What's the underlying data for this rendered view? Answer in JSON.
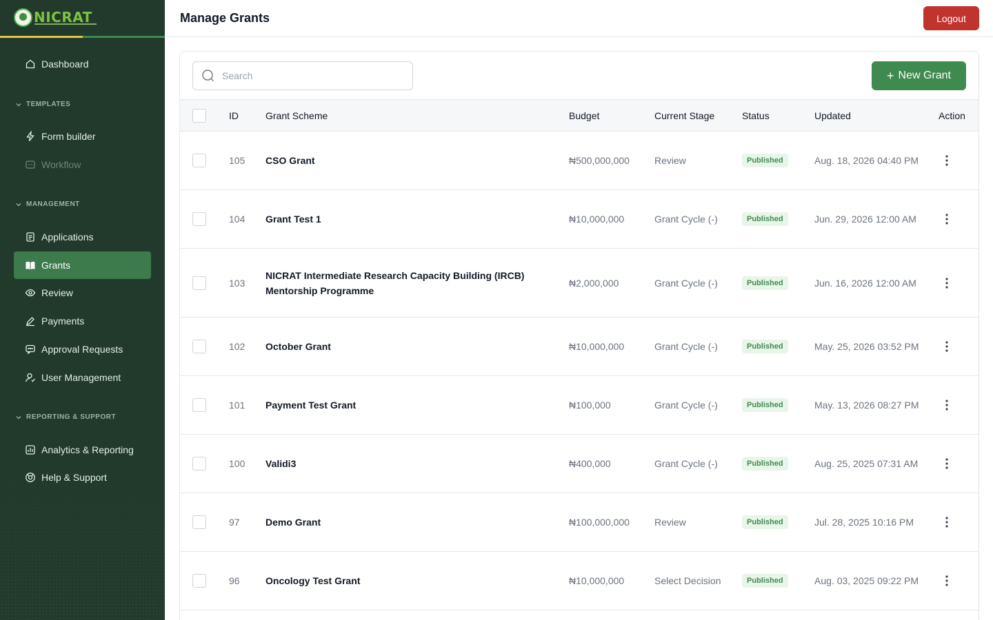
{
  "brand": {
    "name": "NICRAT"
  },
  "sidebar": {
    "items": [
      {
        "label": "Dashboard"
      },
      {
        "label": "Form builder"
      },
      {
        "label": "Workflow"
      },
      {
        "label": "Applications"
      },
      {
        "label": "Grants"
      },
      {
        "label": "Review"
      },
      {
        "label": "Payments"
      },
      {
        "label": "Approval Requests"
      },
      {
        "label": "User Management"
      },
      {
        "label": "Analytics & Reporting"
      },
      {
        "label": "Help & Support"
      }
    ],
    "sections": [
      {
        "label": "TEMPLATES"
      },
      {
        "label": "MANAGEMENT"
      },
      {
        "label": "REPORTING & SUPPORT"
      }
    ],
    "active_item": "Grants"
  },
  "header": {
    "title": "Manage Grants",
    "logout_label": "Logout"
  },
  "toolbar": {
    "search_placeholder": "Search",
    "search_value": "",
    "new_grant_label": "New Grant"
  },
  "table": {
    "columns": [
      "ID",
      "Grant Scheme",
      "Budget",
      "Current Stage",
      "Status",
      "Updated",
      "Action"
    ],
    "rows": [
      {
        "id": "105",
        "name": "CSO Grant",
        "budget": "₦500,000,000",
        "stage": "Review",
        "status": "Published",
        "updated": "Aug. 18, 2026 04:40 PM"
      },
      {
        "id": "104",
        "name": "Grant Test 1",
        "budget": "₦10,000,000",
        "stage": "Grant Cycle (-)",
        "status": "Published",
        "updated": "Jun. 29, 2026 12:00 AM"
      },
      {
        "id": "103",
        "name": "NICRAT Intermediate Research Capacity Building (IRCB) Mentorship Programme",
        "budget": "₦2,000,000",
        "stage": "Grant Cycle (-)",
        "status": "Published",
        "updated": "Jun. 16, 2026 12:00 AM"
      },
      {
        "id": "102",
        "name": "October Grant",
        "budget": "₦10,000,000",
        "stage": "Grant Cycle (-)",
        "status": "Published",
        "updated": "May. 25, 2026 03:52 PM"
      },
      {
        "id": "101",
        "name": "Payment Test Grant",
        "budget": "₦100,000",
        "stage": "Grant Cycle (-)",
        "status": "Published",
        "updated": "May. 13, 2026 08:27 PM"
      },
      {
        "id": "100",
        "name": "Validi3",
        "budget": "₦400,000",
        "stage": "Grant Cycle (-)",
        "status": "Published",
        "updated": "Aug. 25, 2025 07:31 AM"
      },
      {
        "id": "97",
        "name": "Demo Grant",
        "budget": "₦100,000,000",
        "stage": "Review",
        "status": "Published",
        "updated": "Jul. 28, 2025 10:16 PM"
      },
      {
        "id": "96",
        "name": "Oncology Test Grant",
        "budget": "₦10,000,000",
        "stage": "Select Decision",
        "status": "Published",
        "updated": "Aug. 03, 2025 09:22 PM"
      }
    ]
  },
  "colors": {
    "sidebar_bg": "#213a2b",
    "accent_green": "#3f8a4e",
    "logout_red": "#c0342e",
    "badge_bg": "#e8f5e9"
  }
}
